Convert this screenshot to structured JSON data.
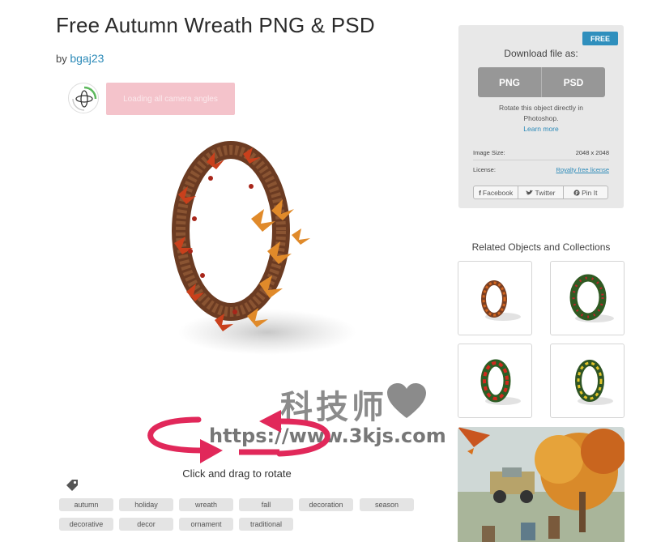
{
  "page": {
    "title": "Free Autumn Wreath PNG & PSD",
    "by_prefix": "by",
    "author": "bgaj23"
  },
  "viewer": {
    "loading_label": "Loading all camera angles",
    "rotate_hint": "Click and drag to rotate"
  },
  "tags": [
    "autumn",
    "holiday",
    "wreath",
    "fall",
    "decoration",
    "season",
    "decorative",
    "decor",
    "ornament",
    "traditional"
  ],
  "download": {
    "badge": "FREE",
    "label": "Download file as:",
    "formats": [
      "PNG",
      "PSD"
    ],
    "note": "Rotate this object directly in Photoshop.",
    "learn_more": "Learn more",
    "image_size_label": "Image Size:",
    "image_size_value": "2048 x 2048",
    "license_label": "License:",
    "license_value": "Royalty free license",
    "share": {
      "facebook": "Facebook",
      "twitter": "Twitter",
      "pinterest": "Pin It"
    }
  },
  "related": {
    "title": "Related Objects and Collections"
  },
  "watermark": {
    "cn": "科技师",
    "url": "https://www.3kjs.com"
  },
  "colors": {
    "accent": "#2f8fbd",
    "loading_bg": "#f4c3cb",
    "arrow": "#e1285a",
    "panel_bg": "#e8e8e8",
    "format_btn": "#979797"
  },
  "icons": [
    "rotate-360-icon",
    "tag-icon",
    "facebook-icon",
    "twitter-icon",
    "pinterest-icon",
    "heart-icon"
  ]
}
